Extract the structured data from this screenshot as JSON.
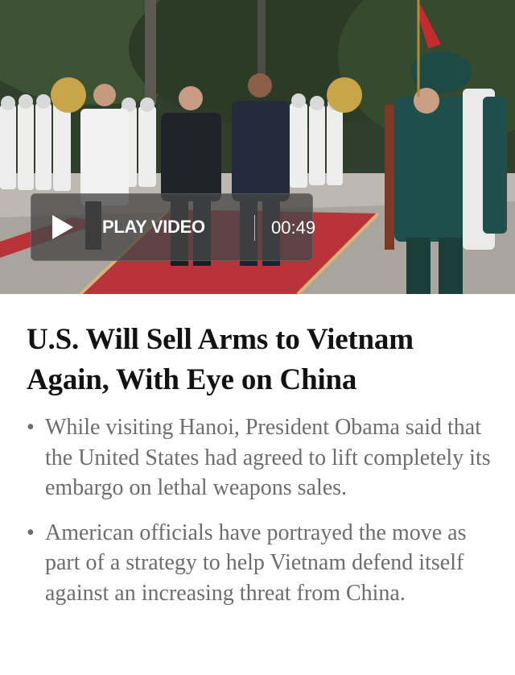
{
  "article": {
    "video": {
      "play_label": "PLAY VIDEO",
      "duration": "00:49"
    },
    "headline": "U.S. Will Sell Arms to Vietnam Again, With Eye on China",
    "summary": [
      "While visiting Hanoi, President Obama said that the United States had agreed to lift completely its embargo on lethal weapons sales.",
      "American officials have portrayed the move as part of a strategy to help Vietnam defend itself against an increasing threat from China."
    ]
  },
  "colors": {
    "headline": "#121212",
    "summary_text": "#6d6d6d",
    "carpet": "#b8333a",
    "uniform_white": "#eeeeee",
    "uniform_green": "#1f4f4a",
    "foliage": "#314529"
  }
}
